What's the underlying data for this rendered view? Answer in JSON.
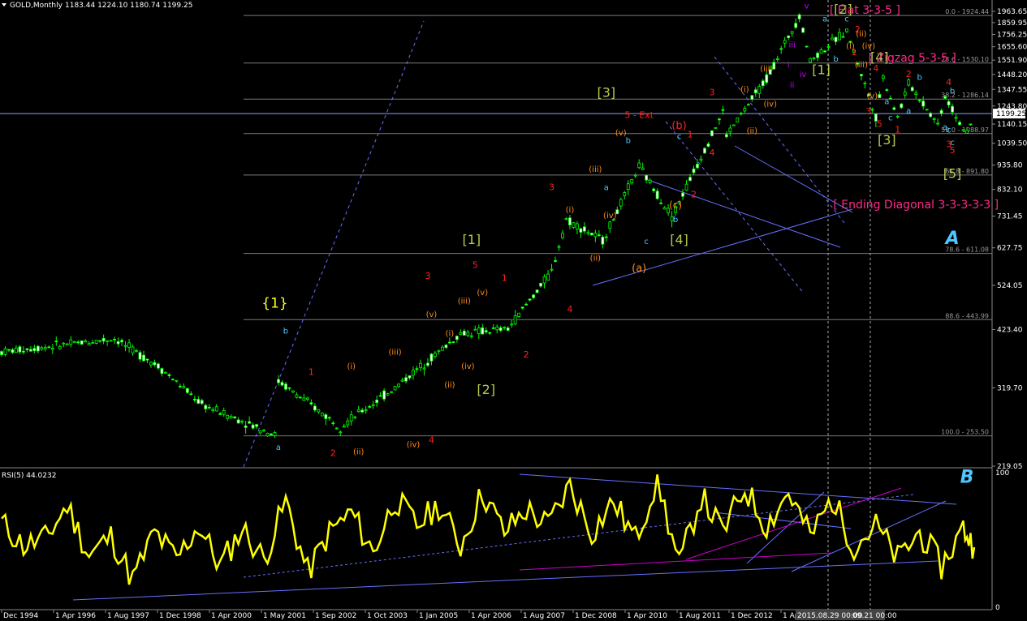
{
  "header": {
    "symbol": "GOLD,Monthly",
    "ohlc": "1183.44 1224.10 1180.74 1199.25",
    "rsi_label": "RSI(5) 44.0232"
  },
  "colors": {
    "background": "#000000",
    "candle": "#00ff00",
    "rsi": "#ffff00",
    "trend_blue": "#6670ff",
    "magenta": "#d000d0",
    "annot_pink": "#ff2a8a",
    "annot_green": "#b6c84e",
    "annot_red": "#ff2020",
    "annot_cyan": "#4ec6ff",
    "annot_orange": "#ff8c1a",
    "annot_yellow": "#ffff20",
    "grid_gray": "#7a7a7a"
  },
  "chart_data": [
    {
      "type": "candlestick",
      "title": "GOLD,Monthly",
      "y_scale": "log",
      "ylim": [
        219.05,
        1963.65
      ],
      "xlim": [
        "Jun 1993",
        "Sep 2015"
      ],
      "y_tick_labels": [
        "1963.65",
        "1859.95",
        "1756.25",
        "1655.60",
        "1551.90",
        "1448.20",
        "1347.55",
        "1243.80",
        "1140.15",
        "1039.50",
        "935.80",
        "832.10",
        "731.45",
        "627.75",
        "524.05",
        "423.40",
        "319.70",
        "219.05"
      ],
      "x_tick_labels": [
        "Dec 1994",
        "1 Apr 1996",
        "1 Aug 1997",
        "1 Dec 1998",
        "1 Apr 2000",
        "1 May 2001",
        "1 Sep 2002",
        "1 Oct 2003",
        "1 Jan 2005",
        "1 Apr 2006",
        "1 Aug 2007",
        "1 Dec 2008",
        "1 Apr 2010",
        "1 Aug 2011",
        "1 Dec 2012",
        "1 Apr"
      ],
      "x_scale_label": "2015.08.29 00:00",
      "x_scale_label2": "09.21 00:00",
      "current_price": "1199.25",
      "price_path": [
        {
          "t": "Jun 1993",
          "p": 380
        },
        {
          "t": "Jan 1996",
          "p": 405
        },
        {
          "t": "Jan 1997",
          "p": 355
        },
        {
          "t": "Jan 1998",
          "p": 295
        },
        {
          "t": "Sep 1999",
          "p": 255
        },
        {
          "t": "Oct 1999",
          "p": 330
        },
        {
          "t": "Mar 2001",
          "p": 265
        },
        {
          "t": "Jun 2002",
          "p": 320
        },
        {
          "t": "Dec 2003",
          "p": 415
        },
        {
          "t": "Jan 2005",
          "p": 425
        },
        {
          "t": "Jan 2006",
          "p": 560
        },
        {
          "t": "May 2006",
          "p": 720
        },
        {
          "t": "Mar 2007",
          "p": 650
        },
        {
          "t": "Jan 2008",
          "p": 930
        },
        {
          "t": "Oct 2008",
          "p": 730
        },
        {
          "t": "Dec 2009",
          "p": 1210
        },
        {
          "t": "Jan 2010",
          "p": 1080
        },
        {
          "t": "Dec 2010",
          "p": 1420
        },
        {
          "t": "Sep 2011",
          "p": 1924
        },
        {
          "t": "Dec 2011",
          "p": 1550
        },
        {
          "t": "Oct 2012",
          "p": 1790
        },
        {
          "t": "Jun 2013",
          "p": 1180
        },
        {
          "t": "Aug 2013",
          "p": 1430
        },
        {
          "t": "Dec 2013",
          "p": 1180
        },
        {
          "t": "Mar 2014",
          "p": 1390
        },
        {
          "t": "Nov 2014",
          "p": 1140
        },
        {
          "t": "Jan 2015",
          "p": 1300
        },
        {
          "t": "Jul 2015",
          "p": 1080
        },
        {
          "t": "Sep 2015",
          "p": 1199
        }
      ],
      "fib_levels": [
        {
          "label": "0.0 - 1924.44",
          "price": 1924.44
        },
        {
          "label": "23.6 - 1530.10",
          "price": 1530.1
        },
        {
          "label": "38.2 - 1286.14",
          "price": 1286.14
        },
        {
          "label": "50.0 - 1088.97",
          "price": 1088.97
        },
        {
          "label": "61.8 - 891.80",
          "price": 891.8
        },
        {
          "label": "78.6 - 611.08",
          "price": 611.08
        },
        {
          "label": "88.6 - 443.99",
          "price": 443.99
        },
        {
          "label": "100.0 - 253.50",
          "price": 253.5
        }
      ],
      "annotations": [
        {
          "text": "{1}",
          "t": "Sep 1999",
          "p": 470,
          "c": "annot_yellow",
          "sz": 17
        },
        {
          "text": "b",
          "t": "Dec 1999",
          "p": 415,
          "c": "annot_cyan",
          "sz": 10
        },
        {
          "text": "a",
          "t": "Oct 1999",
          "p": 237,
          "c": "annot_cyan",
          "sz": 10
        },
        {
          "text": "1",
          "t": "Jul 2000",
          "p": 340,
          "c": "annot_red",
          "sz": 11
        },
        {
          "text": "(i)",
          "t": "Jun 2001",
          "p": 350,
          "c": "annot_orange",
          "sz": 10
        },
        {
          "text": "2",
          "t": "Jan 2001",
          "p": 230,
          "c": "annot_red",
          "sz": 11
        },
        {
          "text": "(ii)",
          "t": "Aug 2001",
          "p": 232,
          "c": "annot_orange",
          "sz": 10
        },
        {
          "text": "(iii)",
          "t": "Jun 2002",
          "p": 375,
          "c": "annot_orange",
          "sz": 10
        },
        {
          "text": "(iv)",
          "t": "Nov 2002",
          "p": 240,
          "c": "annot_orange",
          "sz": 10
        },
        {
          "text": "3",
          "t": "Mar 2003",
          "p": 540,
          "c": "annot_red",
          "sz": 11
        },
        {
          "text": "(v)",
          "t": "Apr 2003",
          "p": 450,
          "c": "annot_orange",
          "sz": 10
        },
        {
          "text": "4",
          "t": "Apr 2003",
          "p": 245,
          "c": "annot_red",
          "sz": 11
        },
        {
          "text": "(i)",
          "t": "Sep 2003",
          "p": 410,
          "c": "annot_orange",
          "sz": 10
        },
        {
          "text": "(ii)",
          "t": "Sep 2003",
          "p": 320,
          "c": "annot_orange",
          "sz": 10
        },
        {
          "text": "[1]",
          "t": "Mar 2004",
          "p": 640,
          "c": "annot_green",
          "sz": 16
        },
        {
          "text": "5",
          "t": "Apr 2004",
          "p": 570,
          "c": "annot_red",
          "sz": 11
        },
        {
          "text": "(iii)",
          "t": "Jan 2004",
          "p": 480,
          "c": "annot_orange",
          "sz": 10
        },
        {
          "text": "(v)",
          "t": "Jun 2004",
          "p": 500,
          "c": "annot_orange",
          "sz": 10
        },
        {
          "text": "(iv)",
          "t": "Feb 2004",
          "p": 350,
          "c": "annot_orange",
          "sz": 10
        },
        {
          "text": "[2]",
          "t": "Jul 2004",
          "p": 310,
          "c": "annot_green",
          "sz": 16
        },
        {
          "text": "1",
          "t": "Dec 2004",
          "p": 535,
          "c": "annot_red",
          "sz": 11
        },
        {
          "text": "2",
          "t": "Jun 2005",
          "p": 370,
          "c": "annot_red",
          "sz": 11
        },
        {
          "text": "3",
          "t": "Jan 2006",
          "p": 830,
          "c": "annot_red",
          "sz": 11
        },
        {
          "text": "4",
          "t": "Jun 2006",
          "p": 460,
          "c": "annot_red",
          "sz": 11
        },
        {
          "text": "(i)",
          "t": "Jun 2006",
          "p": 745,
          "c": "annot_orange",
          "sz": 10
        },
        {
          "text": "(ii)",
          "t": "Jan 2007",
          "p": 590,
          "c": "annot_orange",
          "sz": 10
        },
        {
          "text": "(iii)",
          "t": "Jan 2007",
          "p": 905,
          "c": "annot_orange",
          "sz": 10
        },
        {
          "text": "(iv)",
          "t": "May 2007",
          "p": 725,
          "c": "annot_orange",
          "sz": 10
        },
        {
          "text": "(v)",
          "t": "Aug 2007",
          "p": 1080,
          "c": "annot_orange",
          "sz": 10
        },
        {
          "text": "b",
          "t": "Oct 2007",
          "p": 1040,
          "c": "annot_cyan",
          "sz": 10
        },
        {
          "text": "a",
          "t": "Apr 2007",
          "p": 830,
          "c": "annot_cyan",
          "sz": 10
        },
        {
          "text": "5 - Ext",
          "t": "Jan 2008",
          "p": 1175,
          "c": "annot_red",
          "sz": 11
        },
        {
          "text": "[3]",
          "t": "Apr 2007",
          "p": 1300,
          "c": "annot_green",
          "sz": 16
        },
        {
          "text": "(b)",
          "t": "Dec 2008",
          "p": 1115,
          "c": "annot_red",
          "sz": 13
        },
        {
          "text": "c",
          "t": "Dec 2008",
          "p": 1060,
          "c": "annot_cyan",
          "sz": 10
        },
        {
          "text": "1",
          "t": "Mar 2009",
          "p": 1070,
          "c": "annot_red",
          "sz": 11
        },
        {
          "text": "(c)",
          "t": "Nov 2008",
          "p": 760,
          "c": "annot_orange",
          "sz": 12
        },
        {
          "text": "2",
          "t": "Apr 2009",
          "p": 800,
          "c": "annot_red",
          "sz": 11
        },
        {
          "text": "b",
          "t": "Nov 2008",
          "p": 710,
          "c": "annot_cyan",
          "sz": 10
        },
        {
          "text": "c",
          "t": "Mar 2008",
          "p": 640,
          "c": "annot_cyan",
          "sz": 10
        },
        {
          "text": "[4]",
          "t": "Dec 2008",
          "p": 640,
          "c": "annot_green",
          "sz": 16
        },
        {
          "text": "(a)",
          "t": "Jan 2008",
          "p": 560,
          "c": "annot_orange",
          "sz": 13
        },
        {
          "text": "4",
          "t": "Sep 2009",
          "p": 980,
          "c": "annot_red",
          "sz": 11
        },
        {
          "text": "3",
          "t": "Sep 2009",
          "p": 1310,
          "c": "annot_red",
          "sz": 11
        },
        {
          "text": "(i)",
          "t": "Jun 2010",
          "p": 1330,
          "c": "annot_orange",
          "sz": 10
        },
        {
          "text": "(ii)",
          "t": "Aug 2010",
          "p": 1090,
          "c": "annot_orange",
          "sz": 10
        },
        {
          "text": "(iii)",
          "t": "Dec 2010",
          "p": 1470,
          "c": "annot_orange",
          "sz": 10
        },
        {
          "text": "(iv)",
          "t": "Jan 2011",
          "p": 1240,
          "c": "annot_orange",
          "sz": 10
        },
        {
          "text": "i",
          "t": "Jun 2011",
          "p": 1500,
          "c": "annot_magenta",
          "sz": 10
        },
        {
          "text": "ii",
          "t": "Jul 2011",
          "p": 1360,
          "c": "annot_magenta",
          "sz": 10
        },
        {
          "text": "iii",
          "t": "Jul 2011",
          "p": 1650,
          "c": "annot_magenta",
          "sz": 10
        },
        {
          "text": "iv",
          "t": "Oct 2011",
          "p": 1430,
          "c": "annot_magenta",
          "sz": 10
        },
        {
          "text": "v",
          "t": "Nov 2011",
          "p": 1990,
          "c": "annot_magenta",
          "sz": 10
        },
        {
          "text": "a",
          "t": "Apr 2012",
          "p": 1870,
          "c": "annot_cyan",
          "sz": 10
        },
        {
          "text": "c",
          "t": "Oct 2012",
          "p": 1870,
          "c": "annot_cyan",
          "sz": 10
        },
        {
          "text": "[2]",
          "t": "Sep 2012",
          "p": 1940,
          "c": "annot_green",
          "sz": 16
        },
        {
          "text": "[ Flat 3-3-5 ]",
          "t": "Mar 2013",
          "p": 1940,
          "c": "annot_pink",
          "sz": 14
        },
        {
          "text": "[1]",
          "t": "Mar 2012",
          "p": 1450,
          "c": "annot_green",
          "sz": 16
        },
        {
          "text": "b",
          "t": "Jul 2012",
          "p": 1540,
          "c": "annot_cyan",
          "sz": 10
        },
        {
          "text": "2",
          "t": "Jan 2013",
          "p": 1775,
          "c": "annot_red",
          "sz": 11
        },
        {
          "text": "(i)",
          "t": "Nov 2012",
          "p": 1640,
          "c": "annot_orange",
          "sz": 10
        },
        {
          "text": "1",
          "t": "Dec 2012",
          "p": 1590,
          "c": "annot_red",
          "sz": 11
        },
        {
          "text": "(ii)",
          "t": "Feb 2013",
          "p": 1740,
          "c": "annot_orange",
          "sz": 10
        },
        {
          "text": "(iv)",
          "t": "Apr 2013",
          "p": 1640,
          "c": "annot_orange",
          "sz": 10
        },
        {
          "text": "(iii)",
          "t": "Feb 2013",
          "p": 1500,
          "c": "annot_orange",
          "sz": 10
        },
        {
          "text": "[4]",
          "t": "Jul 2013",
          "p": 1540,
          "c": "annot_green",
          "sz": 16
        },
        {
          "text": "[ Zigzag 5-3-5 ]",
          "t": "Apr 2014",
          "p": 1540,
          "c": "annot_pink",
          "sz": 14
        },
        {
          "text": "4",
          "t": "Jun 2013",
          "p": 1470,
          "c": "annot_red",
          "sz": 11
        },
        {
          "text": "(v)",
          "t": "May 2013",
          "p": 1290,
          "c": "annot_orange",
          "sz": 10
        },
        {
          "text": "a",
          "t": "Sep 2013",
          "p": 1255,
          "c": "annot_cyan",
          "sz": 10
        },
        {
          "text": "3",
          "t": "Apr 2013",
          "p": 1195,
          "c": "annot_red",
          "sz": 11
        },
        {
          "text": "5",
          "t": "Jul 2013",
          "p": 1125,
          "c": "annot_red",
          "sz": 11
        },
        {
          "text": "1",
          "t": "Dec 2013",
          "p": 1095,
          "c": "annot_red",
          "sz": 11
        },
        {
          "text": "c",
          "t": "Oct 2013",
          "p": 1160,
          "c": "annot_cyan",
          "sz": 10
        },
        {
          "text": "2",
          "t": "Mar 2014",
          "p": 1430,
          "c": "annot_red",
          "sz": 11
        },
        {
          "text": "b",
          "t": "Jun 2014",
          "p": 1410,
          "c": "annot_cyan",
          "sz": 10
        },
        {
          "text": "a",
          "t": "Mar 2014",
          "p": 1200,
          "c": "annot_cyan",
          "sz": 10
        },
        {
          "text": "c",
          "t": "Feb 2015",
          "p": 1095,
          "c": "annot_cyan",
          "sz": 10
        },
        {
          "text": "4",
          "t": "Feb 2015",
          "p": 1375,
          "c": "annot_red",
          "sz": 11
        },
        {
          "text": "b",
          "t": "Mar 2015",
          "p": 1320,
          "c": "annot_cyan",
          "sz": 10
        },
        {
          "text": "a",
          "t": "Jan 2015",
          "p": 1110,
          "c": "annot_cyan",
          "sz": 10
        },
        {
          "text": "3",
          "t": "Feb 2015",
          "p": 1020,
          "c": "annot_red",
          "sz": 11
        },
        {
          "text": "c",
          "t": "Mar 2015",
          "p": 1030,
          "c": "annot_cyan",
          "sz": 10
        },
        {
          "text": "5",
          "t": "Mar 2015",
          "p": 990,
          "c": "annot_red",
          "sz": 11
        },
        {
          "text": "[3]",
          "t": "Sep 2013",
          "p": 1035,
          "c": "annot_green",
          "sz": 16
        },
        {
          "text": "[5]",
          "t": "Mar 2015",
          "p": 880,
          "c": "annot_green",
          "sz": 16
        },
        {
          "text": "[ Ending Diagonal 3-3-3-3-3 ]",
          "t": "May 2014",
          "p": 760,
          "c": "annot_pink",
          "sz": 14
        },
        {
          "text": "A",
          "t": "Mar 2015",
          "p": 640,
          "c": "annot_cyan",
          "sz": 22,
          "italic": true
        }
      ]
    },
    {
      "type": "line",
      "title": "RSI(5) 44.0232",
      "ylim": [
        0,
        100
      ],
      "y_tick_labels": [
        "100",
        "0"
      ],
      "x": [
        "Jun 1993",
        "Dec 1993",
        "Jun 1994",
        "Dec 1994",
        "Jun 1995",
        "Dec 1995",
        "Jun 1996",
        "Dec 1996",
        "Jun 1997",
        "Dec 1997",
        "Jun 1998",
        "Dec 1998",
        "Jun 1999",
        "Dec 1999",
        "Jun 2000",
        "Dec 2000",
        "Jun 2001",
        "Dec 2001",
        "Jun 2002",
        "Dec 2002",
        "Jun 2003",
        "Dec 2003",
        "Jun 2004",
        "Dec 2004",
        "Jun 2005",
        "Dec 2005",
        "Jun 2006",
        "Dec 2006",
        "Jun 2007",
        "Dec 2007",
        "Jun 2008",
        "Dec 2008",
        "Jun 2009",
        "Dec 2009",
        "Jun 2010",
        "Dec 2010",
        "Jun 2011",
        "Dec 2011",
        "Jun 2012",
        "Dec 2012",
        "Jun 2013",
        "Dec 2013",
        "Jun 2014",
        "Dec 2014",
        "Jun 2015",
        "Sep 2015"
      ],
      "values": [
        62,
        45,
        50,
        75,
        38,
        52,
        20,
        55,
        35,
        60,
        30,
        58,
        35,
        78,
        25,
        55,
        70,
        40,
        80,
        60,
        75,
        45,
        85,
        55,
        72,
        60,
        90,
        55,
        78,
        50,
        95,
        30,
        82,
        55,
        88,
        60,
        85,
        52,
        80,
        45,
        60,
        35,
        55,
        30,
        58,
        44
      ],
      "annotations": [
        {
          "text": "B",
          "t": "Jul 2015",
          "v": 92,
          "c": "annot_cyan",
          "sz": 22,
          "italic": true
        }
      ]
    }
  ]
}
